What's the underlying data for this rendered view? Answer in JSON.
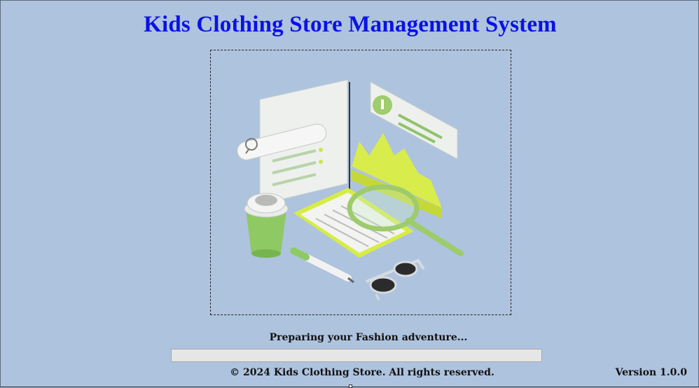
{
  "window": {
    "title": "Kids Clothing Store Management System"
  },
  "illustration": {
    "icon": "analytics-illustration",
    "accent_color": "#d6ea46",
    "secondary_color": "#86c25b"
  },
  "loading": {
    "status_text": "Preparing your Fashion adventure...",
    "progress": 0
  },
  "footer": {
    "copyright": "© 2024 Kids Clothing Store. All rights reserved.",
    "version": "Version 1.0.0"
  },
  "colors": {
    "background": "#aec3de",
    "title": "#0a12e6"
  }
}
